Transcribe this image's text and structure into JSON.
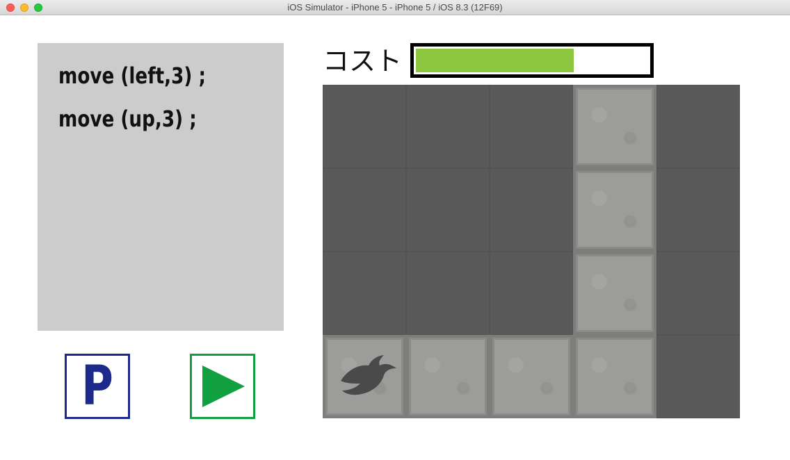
{
  "window": {
    "title": "iOS Simulator - iPhone 5 - iPhone 5 / iOS 8.3 (12F69)"
  },
  "code": {
    "lines": [
      "move (left,3) ;",
      "move (up,3) ;"
    ]
  },
  "buttons": {
    "program_label": "P",
    "play_icon": "play-triangle-icon"
  },
  "cost": {
    "label": "コスト",
    "level_fraction": 0.68,
    "fill_color": "#8dc63f"
  },
  "board": {
    "columns": 5,
    "rows": 4,
    "cells": [
      [
        "dark",
        "dark",
        "dark",
        "light",
        "dark"
      ],
      [
        "dark",
        "dark",
        "dark",
        "light",
        "dark"
      ],
      [
        "dark",
        "dark",
        "dark",
        "light",
        "dark"
      ],
      [
        "light",
        "light",
        "light",
        "light",
        "dark"
      ]
    ],
    "player": {
      "row": 3,
      "col": 0,
      "icon": "bird-icon"
    }
  },
  "colors": {
    "program_button": "#1c2a8c",
    "play_button": "#10a040",
    "code_panel": "#cccccc"
  }
}
